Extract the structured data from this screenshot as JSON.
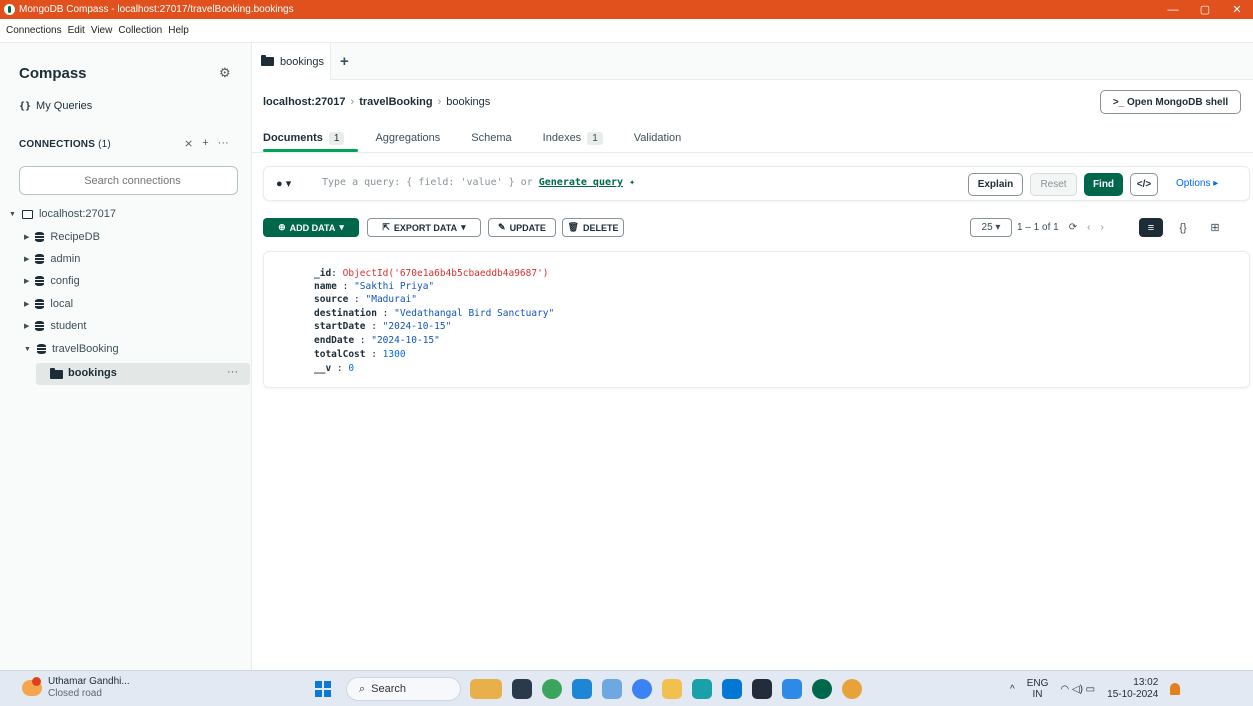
{
  "window": {
    "title": "MongoDB Compass - localhost:27017/travelBooking.bookings",
    "minimize": "—",
    "maximize": "▢",
    "close": "✕"
  },
  "menu": [
    "Connections",
    "Edit",
    "View",
    "Collection",
    "Help"
  ],
  "sidebar": {
    "title": "Compass",
    "my_queries": "My Queries",
    "connections_label": "CONNECTIONS",
    "connections_count": "(1)",
    "search_placeholder": "Search connections",
    "host": "localhost:27017",
    "databases": [
      "RecipeDB",
      "admin",
      "config",
      "local",
      "student",
      "travelBooking"
    ],
    "selected_collection": "bookings"
  },
  "tabs": {
    "active": "bookings"
  },
  "breadcrumb": {
    "host": "localhost:27017",
    "db": "travelBooking",
    "collection": "bookings"
  },
  "shell_button": ">_ Open MongoDB shell",
  "subtabs": [
    {
      "label": "Documents",
      "badge": "1"
    },
    {
      "label": "Aggregations",
      "badge": ""
    },
    {
      "label": "Schema",
      "badge": ""
    },
    {
      "label": "Indexes",
      "badge": "1"
    },
    {
      "label": "Validation",
      "badge": ""
    }
  ],
  "query": {
    "placeholder_prefix": "Type a query: { field: 'value' } or ",
    "generate_label": "Generate query",
    "explain": "Explain",
    "reset": "Reset",
    "find": "Find",
    "code": "</>",
    "options": "Options ▸"
  },
  "toolbar": {
    "add": "ADD DATA",
    "export": "EXPORT DATA",
    "update": "UPDATE",
    "delete": "DELETE",
    "page_size": "25",
    "range": "1 – 1 of 1"
  },
  "document": [
    {
      "key": "_id",
      "value": "ObjectId('670e1a6b4b5cbaeddb4a9687')",
      "type": "oid"
    },
    {
      "key": "name",
      "value": "\"Sakthi Priya\"",
      "type": "s"
    },
    {
      "key": "source",
      "value": "\"Madurai\"",
      "type": "s"
    },
    {
      "key": "destination",
      "value": "\"Vedathangal Bird Sanctuary\"",
      "type": "s"
    },
    {
      "key": "startDate",
      "value": "\"2024-10-15\"",
      "type": "s"
    },
    {
      "key": "endDate",
      "value": "\"2024-10-15\"",
      "type": "s"
    },
    {
      "key": "totalCost",
      "value": "1300",
      "type": "n"
    },
    {
      "key": "__v",
      "value": "0",
      "type": "n"
    }
  ],
  "taskbar": {
    "weather_title": "Uthamar Gandhi...",
    "weather_sub": "Closed road",
    "search": "Search",
    "lang1": "ENG",
    "lang2": "IN",
    "time": "13:02",
    "date": "15-10-2024"
  },
  "colors": {
    "titlebar": "#e1511d",
    "accent_green": "#00684a",
    "tab_underline": "#00a35c",
    "link_blue": "#016bf8"
  }
}
